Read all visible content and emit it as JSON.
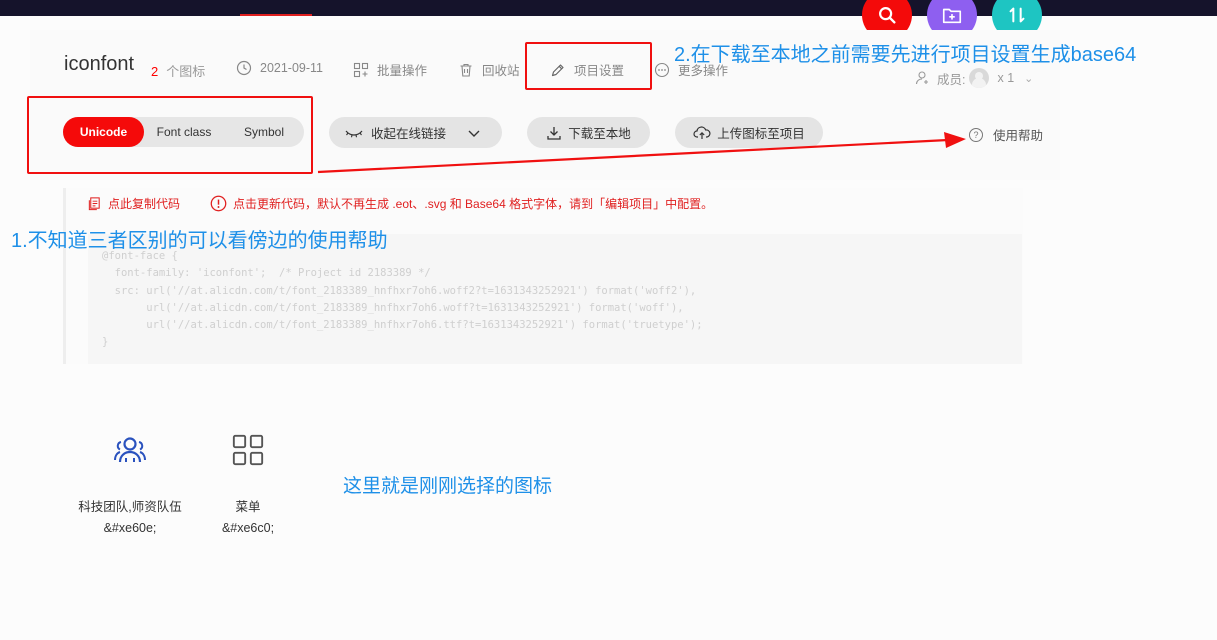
{
  "header": {
    "project_title": "iconfont",
    "icon_count": "2",
    "icon_count_label": "个图标",
    "date": "2021-09-11",
    "batch_label": "批量操作",
    "trash_label": "回收站",
    "settings_label": "项目设置",
    "more_label": "更多操作",
    "members_label": "成员:",
    "members_count": "x 1"
  },
  "tabs": {
    "unicode": "Unicode",
    "font_class": "Font class",
    "symbol": "Symbol",
    "active": "Unicode"
  },
  "actions": {
    "collapse_link": "收起在线链接",
    "download": "下载至本地",
    "upload": "上传图标至项目",
    "help": "使用帮助"
  },
  "code_panel": {
    "copy_label": "点此复制代码",
    "tip": "点击更新代码，默认不再生成 .eot、.svg 和 Base64 格式字体，请到「编辑项目」中配置。",
    "lines": [
      "@font-face {",
      "  font-family: 'iconfont';  /* Project id 2183389 */",
      "  src: url('//at.alicdn.com/t/font_2183389_hnfhxr7oh6.woff2?t=1631343252921') format('woff2'),",
      "       url('//at.alicdn.com/t/font_2183389_hnfhxr7oh6.woff?t=1631343252921') format('woff'),",
      "       url('//at.alicdn.com/t/font_2183389_hnfhxr7oh6.ttf?t=1631343252921') format('truetype');",
      "}"
    ]
  },
  "glyphs": [
    {
      "name": "科技团队,师资队伍",
      "code": "&#xe60e;",
      "icon": "team-icon"
    },
    {
      "name": "菜单",
      "code": "&#xe6c0;",
      "icon": "menu-grid-icon"
    }
  ],
  "annotations": {
    "note_1": "1.不知道三者区别的可以看傍边的使用帮助",
    "note_2": "2.在下载至本地之前需要先进行项目设置生成base64",
    "note_3": "这里就是刚刚选择的图标"
  },
  "colors": {
    "brand_red": "#f50a0a",
    "annotation_blue": "#1e90e8",
    "fab_search": "#f40a0a",
    "fab_add": "#8e5ff0",
    "fab_sort": "#1ec5c2",
    "topbar": "#15132b"
  },
  "icons": {
    "fab_search": "search-icon",
    "fab_add": "folder-add-icon",
    "fab_sort": "sort-icon"
  }
}
